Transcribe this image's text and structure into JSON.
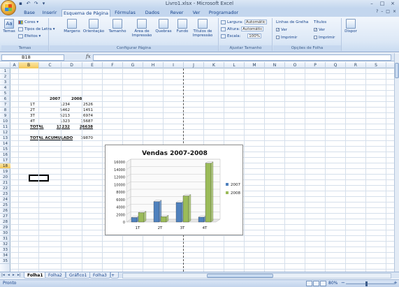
{
  "window": {
    "title": "Livro1.xlsx - Microsoft Excel",
    "controls": [
      "–",
      "□",
      "×"
    ]
  },
  "qat": [
    "save-icon",
    "undo-icon",
    "redo-icon",
    "customize-icon"
  ],
  "ribbon_tabs": [
    "Base",
    "Inserir",
    "Esquema de Página",
    "Fórmulas",
    "Dados",
    "Rever",
    "Ver",
    "Programador"
  ],
  "active_tab": "Esquema de Página",
  "ribbon_controls": [
    "?",
    "–",
    "□",
    "×"
  ],
  "ribbon": {
    "temas": {
      "label": "Temas",
      "big": "Temas",
      "cores": "Cores",
      "tipos_letra": "Tipos de Letra",
      "efeitos": "Efeitos"
    },
    "configurar": {
      "label": "Configurar Página",
      "margens": "Margens",
      "orientacao": "Orientação",
      "tamanho": "Tamanho",
      "area": "Área de Impressão",
      "quebras": "Quebras",
      "fundo": "Fundo",
      "titulos": "Títulos de Impressão"
    },
    "ajustar": {
      "label": "Ajustar Tamanho",
      "largura": "Largura:",
      "largura_val": "Automátic",
      "altura": "Altura:",
      "altura_val": "Automátic",
      "escala": "Escala:",
      "escala_val": "100%"
    },
    "opcoes": {
      "label": "Opções de Folha",
      "linhas": "Linhas de Grelha",
      "titulos": "Títulos",
      "ver1": "Ver",
      "imprimir1": "Imprimir",
      "ver2": "Ver",
      "imprimir2": "Imprimir"
    },
    "dispor": {
      "label": "Dispor"
    }
  },
  "formula_bar": {
    "name_box": "B18",
    "fx": "fx",
    "value": ""
  },
  "columns": [
    "A",
    "B",
    "C",
    "D",
    "E",
    "F",
    "G",
    "H",
    "I",
    "J",
    "K",
    "L",
    "M",
    "N",
    "O",
    "P",
    "Q",
    "R",
    "S"
  ],
  "rows": [
    "1",
    "2",
    "3",
    "4",
    "5",
    "6",
    "7",
    "8",
    "9",
    "10",
    "11",
    "12",
    "13",
    "14",
    "15",
    "16",
    "17",
    "18",
    "19",
    "20",
    "21",
    "22",
    "23",
    "24",
    "25",
    "26",
    "27",
    "28",
    "29",
    "30",
    "31",
    "32",
    "33",
    "34",
    "35"
  ],
  "selected_column": "B",
  "selected_row": "18",
  "table": {
    "header_2007": "2007",
    "header_2008": "2008",
    "rows": [
      {
        "label": "1T",
        "v2007": "1234",
        "v2008": "2526"
      },
      {
        "label": "2T",
        "v2007": "5462",
        "v2008": "1451"
      },
      {
        "label": "3T",
        "v2007": "5213",
        "v2008": "6974"
      },
      {
        "label": "4T",
        "v2007": "1323",
        "v2008": "15687"
      }
    ],
    "total_label": "TOTAL",
    "total_2007": "13232",
    "total_2008": "26638",
    "acumulado_label": "TOTAL ACUMULADO",
    "acumulado_value": "39870"
  },
  "chart_data": {
    "type": "bar",
    "title": "Vendas 2007-2008",
    "categories": [
      "1T",
      "2T",
      "3T",
      "4T"
    ],
    "series": [
      {
        "name": "2007",
        "values": [
          1234,
          5462,
          5213,
          1323
        ],
        "color": "#4f81bd"
      },
      {
        "name": "2008",
        "values": [
          2526,
          1451,
          6974,
          15687
        ],
        "color": "#9bbb59"
      }
    ],
    "ylim": [
      0,
      16000
    ],
    "yticks": [
      "0",
      "2000",
      "4000",
      "6000",
      "8000",
      "10000",
      "12000",
      "14000",
      "16000"
    ],
    "legend": "right",
    "grid": true,
    "style": "3d-clustered-column"
  },
  "sheets": [
    "Folha1",
    "Folha2",
    "Gráfico1",
    "Folha3"
  ],
  "active_sheet": "Folha1",
  "status": {
    "ready": "Pronto",
    "zoom": "80%"
  }
}
